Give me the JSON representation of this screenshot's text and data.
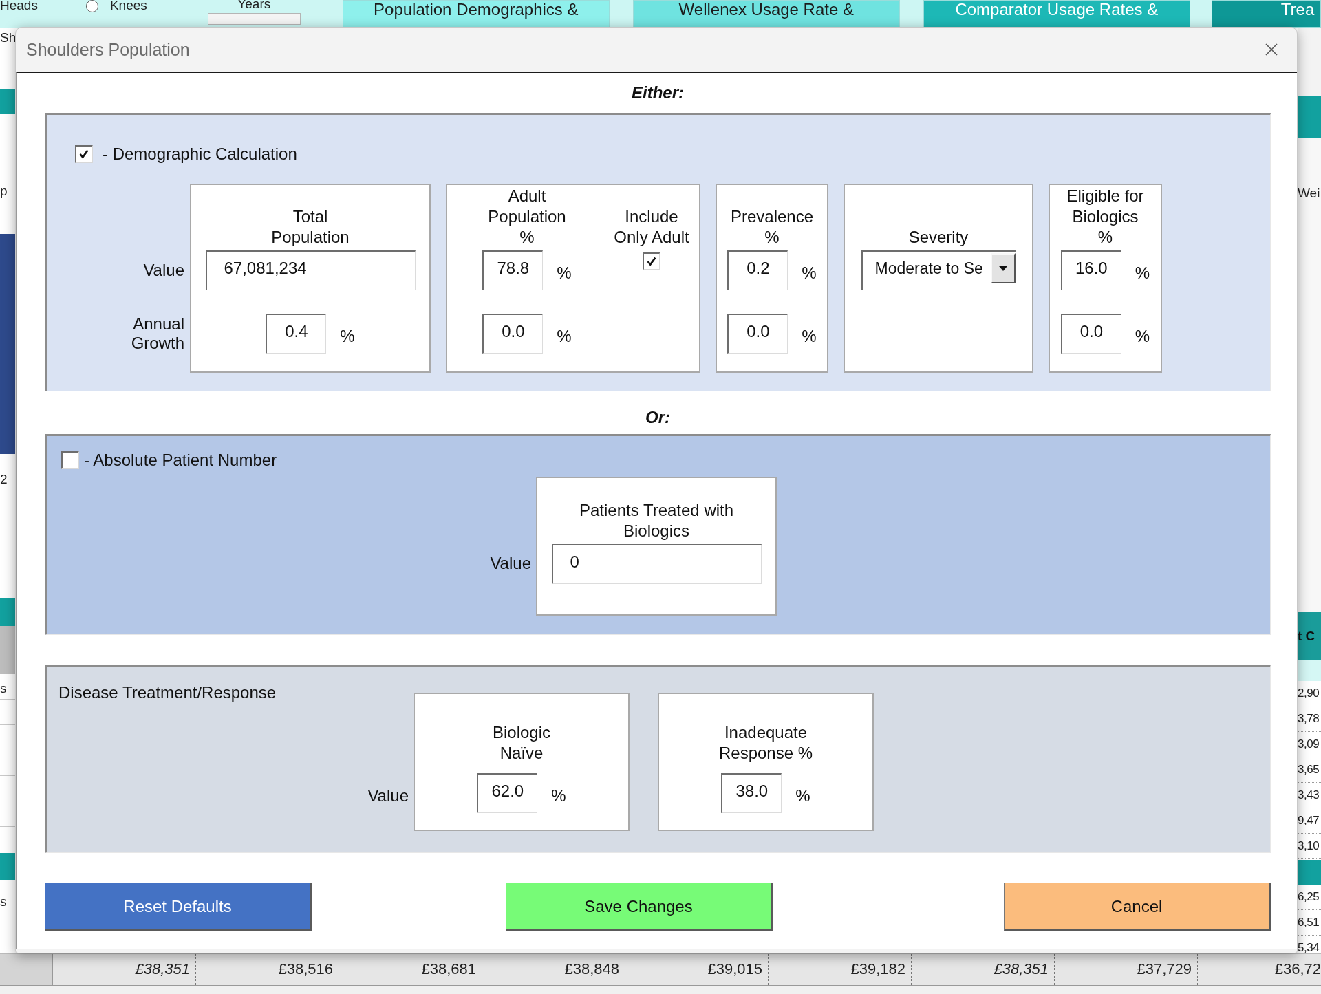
{
  "ribbon": {
    "items": [
      {
        "kind": "text",
        "text": "Heads"
      },
      {
        "kind": "radio",
        "text": "Knees",
        "selected": false
      },
      {
        "kind": "field",
        "text": "Years"
      }
    ],
    "tabs": [
      {
        "label": "Population Demographics &",
        "color": "#8ef0ec"
      },
      {
        "label": "Wellenex Usage Rate &",
        "color": "#6fe3e0"
      },
      {
        "label": "Comparator Usage Rates &",
        "color": "#1db8b6"
      },
      {
        "label": "Trea",
        "color": "#0e9896"
      }
    ]
  },
  "left_edge": [
    "Sh",
    "p",
    "2",
    "s",
    "s"
  ],
  "right_edge": {
    "label": "Wei",
    "header": "t C",
    "values": [
      "2,90",
      "3,78",
      "3,09",
      "3,65",
      "3,43",
      "9,47",
      "3,10"
    ],
    "values_lower": [
      "6,25",
      "6,51",
      "5,34"
    ]
  },
  "bottom_row": [
    {
      "text": "£38,351",
      "italic": true
    },
    {
      "text": "£38,516",
      "italic": false
    },
    {
      "text": "£38,681",
      "italic": false
    },
    {
      "text": "£38,848",
      "italic": false
    },
    {
      "text": "£39,015",
      "italic": false
    },
    {
      "text": "£39,182",
      "italic": false
    },
    {
      "text": "£38,351",
      "italic": true
    },
    {
      "text": "£37,729",
      "italic": false
    },
    {
      "text": "£36,72",
      "italic": false
    }
  ],
  "dialog": {
    "title": "Shoulders Population",
    "either_label": "Either:",
    "demographic": {
      "checked": true,
      "label": "- Demographic Calculation",
      "value_label": "Value",
      "growth_label": "Annual\nGrowth",
      "columns": [
        {
          "kind": "total",
          "title": "Total\nPopulation",
          "value": "67,081,234",
          "growth": "0.4",
          "growth_unit": "%"
        },
        {
          "kind": "percent",
          "title": "Adult\nPopulation\n%",
          "value": "78.8",
          "value_unit": "%",
          "growth": "0.0",
          "growth_unit": "%",
          "option": {
            "title": "Include\nOnly Adult",
            "checked": true
          }
        },
        {
          "kind": "percent",
          "title": "Prevalence\n%",
          "value": "0.2",
          "value_unit": "%",
          "growth": "0.0",
          "growth_unit": "%"
        },
        {
          "kind": "dropdown",
          "title": "Severity",
          "value": "Moderate to Se"
        },
        {
          "kind": "percent",
          "title": "Eligible for\nBiologics\n%",
          "value": "16.0",
          "value_unit": "%",
          "growth": "0.0",
          "growth_unit": "%"
        }
      ]
    },
    "or_label": "Or:",
    "absolute": {
      "checked": false,
      "label": "- Absolute Patient Number",
      "box_title": "Patients Treated with\nBiologics",
      "value_label": "Value",
      "value": "0"
    },
    "treatment": {
      "title": "Disease Treatment/Response",
      "value_label": "Value",
      "columns": [
        {
          "title": "Biologic\nNaïve",
          "value": "62.0",
          "unit": "%"
        },
        {
          "title": "Inadequate\nResponse %",
          "value": "38.0",
          "unit": "%"
        }
      ]
    },
    "buttons": [
      {
        "label": "Reset Defaults",
        "color": "#4472c4"
      },
      {
        "label": "Save Changes",
        "color": "#77fb77"
      },
      {
        "label": "Cancel",
        "color": "#fbbc7d"
      }
    ]
  }
}
